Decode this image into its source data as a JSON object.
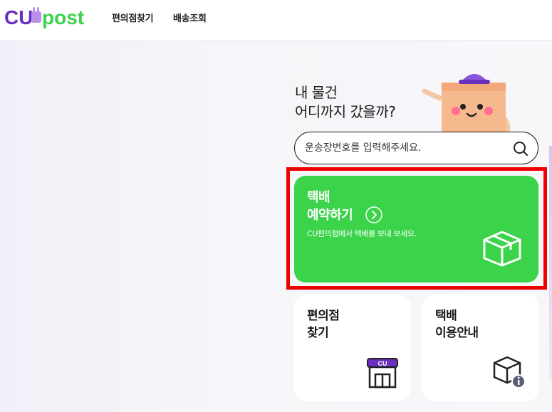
{
  "header": {
    "logo_text": "CUpost",
    "nav": {
      "find_store": "편의점찾기",
      "tracking": "배송조회"
    }
  },
  "hero": {
    "headline_line1": "내 물건",
    "headline_line2": "어디까지 갔을까?"
  },
  "search": {
    "placeholder": "운송장번호를 입력해주세요."
  },
  "reserve_card": {
    "title_line1": "택배",
    "title_line2": "예약하기",
    "description": "CU편의점에서 택배를 보내 보세요."
  },
  "store_card": {
    "title_line1": "편의점",
    "title_line2": "찾기",
    "sign_text": "CU"
  },
  "guide_card": {
    "title_line1": "택배",
    "title_line2": "이용안내"
  },
  "colors": {
    "brand_purple": "#6b2fbf",
    "brand_green": "#3ad34a",
    "highlight_red": "#ee0000"
  },
  "icons": [
    "search-icon",
    "chevron-right-icon",
    "box-icon",
    "store-icon",
    "info-box-icon"
  ]
}
